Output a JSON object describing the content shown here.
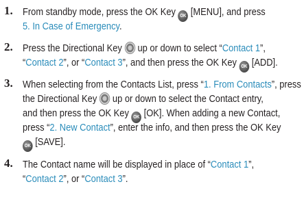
{
  "steps": [
    {
      "number": "1.",
      "lines": [
        [
          {
            "t": "From standby mode, press the OK Key "
          },
          {
            "icon": "ok",
            "label": "OK"
          },
          {
            "t": " [MENU], and press"
          }
        ],
        [
          {
            "t": "5. In Case of Emergency",
            "hl": true
          },
          {
            "t": "."
          }
        ]
      ]
    },
    {
      "number": "2.",
      "lines": [
        [
          {
            "t": "Press the Directional Key "
          },
          {
            "icon": "dir"
          },
          {
            "t": " up or down to select “"
          },
          {
            "t": "Contact 1",
            "hl": true
          },
          {
            "t": "”,"
          }
        ],
        [
          {
            "t": "“"
          },
          {
            "t": "Contact 2",
            "hl": true
          },
          {
            "t": "”, or “"
          },
          {
            "t": "Contact 3",
            "hl": true
          },
          {
            "t": "”, and then press the OK Key "
          },
          {
            "icon": "ok",
            "label": "OK"
          },
          {
            "t": " [ADD]."
          }
        ]
      ]
    },
    {
      "number": "3.",
      "lines": [
        [
          {
            "t": "When selecting from the Contacts List, press “"
          },
          {
            "t": "1. From Contacts",
            "hl": true
          },
          {
            "t": "”, press"
          }
        ],
        [
          {
            "t": "the Directional Key "
          },
          {
            "icon": "dir"
          },
          {
            "t": " up or down to select the Contact entry,"
          }
        ],
        [
          {
            "t": "and then press the OK Key "
          },
          {
            "icon": "ok",
            "label": "OK"
          },
          {
            "t": " [OK]. When adding a new Contact,"
          }
        ],
        [
          {
            "t": "press “"
          },
          {
            "t": "2. New Contact",
            "hl": true
          },
          {
            "t": "”, enter the info, and then press the OK Key"
          }
        ],
        [
          {
            "icon": "ok",
            "label": "OK"
          },
          {
            "t": " [SAVE]."
          }
        ]
      ]
    },
    {
      "number": "4.",
      "lines": [
        [
          {
            "t": "The Contact name will be displayed in place of “"
          },
          {
            "t": "Contact 1",
            "hl": true
          },
          {
            "t": "”,"
          }
        ],
        [
          {
            "t": "“"
          },
          {
            "t": "Contact 2",
            "hl": true
          },
          {
            "t": "”, or “"
          },
          {
            "t": "Contact 3",
            "hl": true
          },
          {
            "t": "”."
          }
        ]
      ]
    }
  ],
  "colors": {
    "text": "#231f20",
    "highlight": "#2a8cba"
  }
}
